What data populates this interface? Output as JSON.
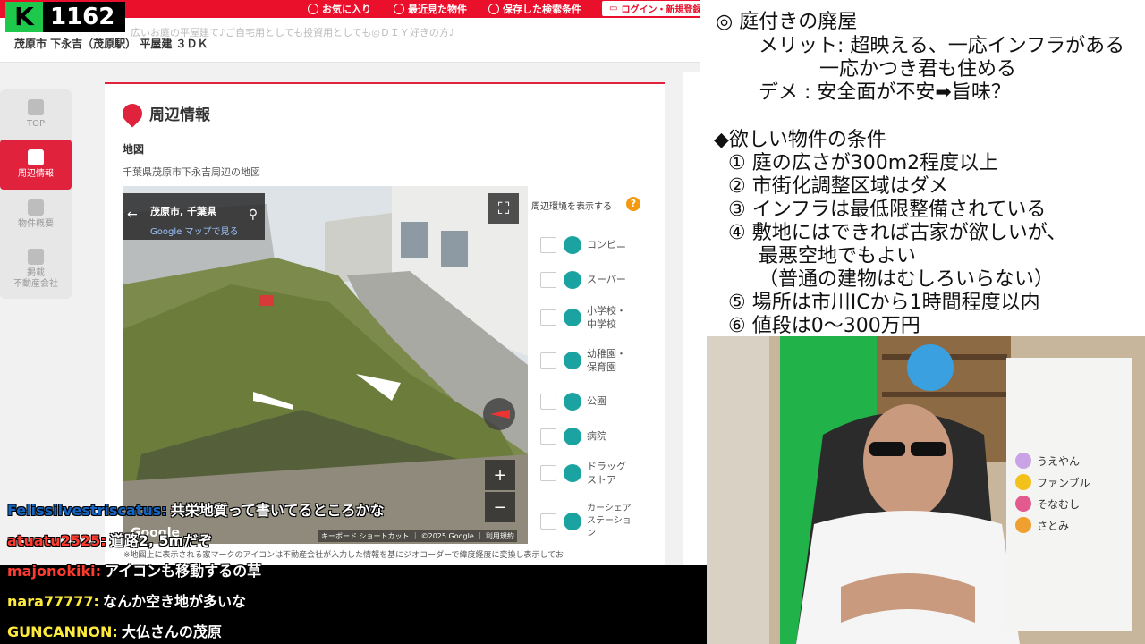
{
  "viewer": {
    "logo": "K",
    "count": "1162"
  },
  "site": {
    "nav": [
      {
        "label": "お気に入り",
        "icon": "heart-icon"
      },
      {
        "label": "最近見た物件",
        "icon": "history-icon"
      },
      {
        "label": "保存した検索条件",
        "icon": "saved-search-icon"
      }
    ],
    "login_label": "ログイン・新規登録",
    "subtitle": "広いお庭の平屋建て♪ご自宅用としても投資用としても◎ＤＩＹ好きの方♪",
    "title": "茂原市 下永吉（茂原駅） 平屋建 ３ＤＫ"
  },
  "sidebar": {
    "items": [
      {
        "label": "TOP",
        "icon": "arrow-up-icon"
      },
      {
        "label": "周辺情報",
        "icon": "map-icon"
      },
      {
        "label": "物件概要",
        "icon": "document-icon"
      },
      {
        "label": "掲載\n不動産会社",
        "icon": "building-icon"
      }
    ]
  },
  "section": {
    "title": "周辺情報",
    "map_label": "地図",
    "map_caption": "千葉県茂原市下永吉周辺の地図",
    "note": "※地図上に表示される家マークのアイコンは不動産会社が入力した情報を基にジオコーダーで緯度経度に変換し表示してお"
  },
  "streetview": {
    "place": "茂原市, 千葉県",
    "map_link": "Google マップで見る",
    "footer": "キーボード ショートカット ｜ ©2025 Google ｜ 利用規約",
    "google": "Google",
    "zoom_in": "+",
    "zoom_out": "−"
  },
  "env": {
    "header": "周辺環境を表示する",
    "help": "?",
    "items": [
      {
        "label": "コンビニ",
        "icon": "convenience-store-icon"
      },
      {
        "label": "スーパー",
        "icon": "cart-icon"
      },
      {
        "label": "小学校・中学校",
        "icon": "school-icon"
      },
      {
        "label": "幼稚園・保育園",
        "icon": "kindergarten-icon"
      },
      {
        "label": "公園",
        "icon": "park-icon"
      },
      {
        "label": "病院",
        "icon": "hospital-icon"
      },
      {
        "label": "ドラッグストア",
        "icon": "drugstore-icon"
      },
      {
        "label": "カーシェアステーション",
        "icon": "car-share-icon"
      }
    ]
  },
  "chat": [
    {
      "user": "Felissilvestriscatus:",
      "message": "共栄地質って書いてるところかな",
      "color": "#1565c0"
    },
    {
      "user": "atuatu2525:",
      "message": "道路2, 5mだぞ",
      "color": "#ff3b30"
    },
    {
      "user": "majonokiki:",
      "message": "アイコンも移動するの草",
      "color": "#ff3b30"
    },
    {
      "user": "nara77777:",
      "message": "なんか空き地が多いな",
      "color": "#ffeb3b"
    },
    {
      "user": "GUNCANNON:",
      "message": "大仏さんの茂原",
      "color": "#ffeb3b"
    }
  ],
  "notes": [
    "◎ 庭付きの廃屋",
    "メリット: 超映える、一応インフラがある",
    "一応かつき君も住める",
    "デメ : 安全面が不安➡旨味？",
    "◆欲しい物件の条件",
    "① 庭の広さが300m2程度以上",
    "② 市街化調整区域はダメ",
    "③ インフラは最低限整備されている",
    "④ 敷地にはできれば古家が欲しいが、",
    "最悪空地でもよい",
    "（普通の建物はむしろいらない）",
    "⑤ 場所は市川ICから1時間程度以内",
    "⑥ 値段は0～300万円"
  ],
  "board": {
    "names": [
      {
        "label": "うえやん",
        "color": "#c9a3e6"
      },
      {
        "label": "ファンブル",
        "color": "#f2c21b"
      },
      {
        "label": "そなむし",
        "color": "#e35a8f"
      },
      {
        "label": "さとみ",
        "color": "#f0a030"
      }
    ]
  }
}
